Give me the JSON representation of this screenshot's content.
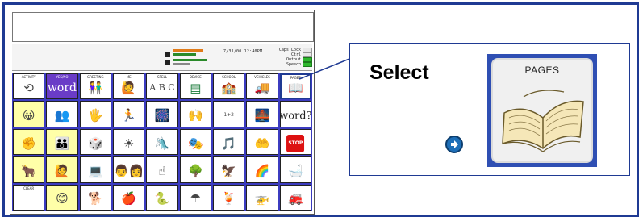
{
  "status": {
    "datetime": "7/31/00 12:40PM",
    "indicators": [
      {
        "label": "Caps Lock",
        "on": false
      },
      {
        "label": "Ctrl",
        "on": false
      },
      {
        "label": "Output",
        "on": true
      },
      {
        "label": "Speech",
        "on": true
      }
    ]
  },
  "keyboard": {
    "nav_keys": [
      {
        "label": "ACTIVITY",
        "icon": "⟲"
      },
      {
        "label": "YES/NO",
        "icon": "word"
      },
      {
        "label": "GREETING",
        "icon": "👫"
      },
      {
        "label": "ME",
        "icon": "🙋"
      },
      {
        "label": "SPELL",
        "icon": "A B C"
      },
      {
        "label": "DEVICE",
        "icon": "▤"
      },
      {
        "label": "SCHOOL",
        "icon": "🏫"
      },
      {
        "label": "VEHICLES",
        "icon": "🚚"
      },
      {
        "label": "PAGES",
        "icon": "📖"
      }
    ],
    "rows": [
      [
        {
          "icon": "😀",
          "yellow": true
        },
        {
          "icon": "👥",
          "yellow": false
        },
        {
          "icon": "🖐",
          "yellow": false
        },
        {
          "icon": "🏃",
          "yellow": false
        },
        {
          "icon": "🎆",
          "yellow": false
        },
        {
          "icon": "🙌",
          "yellow": false
        },
        {
          "icon": "1+2",
          "yellow": false
        },
        {
          "icon": "🌉",
          "yellow": false
        },
        {
          "icon": "word?",
          "yellow": false
        }
      ],
      [
        {
          "icon": "✊",
          "yellow": true
        },
        {
          "icon": "👪",
          "yellow": true
        },
        {
          "icon": "🎲",
          "yellow": false
        },
        {
          "icon": "☀",
          "yellow": false
        },
        {
          "icon": "🛝",
          "yellow": false
        },
        {
          "icon": "🎭",
          "yellow": false
        },
        {
          "icon": "🎵",
          "yellow": false
        },
        {
          "icon": "🤲",
          "yellow": false
        },
        {
          "icon": "STOP",
          "yellow": false
        }
      ],
      [
        {
          "icon": "🐂",
          "yellow": true
        },
        {
          "icon": "🙋",
          "yellow": true
        },
        {
          "icon": "💻",
          "yellow": false
        },
        {
          "icon": "👨‍👩",
          "yellow": false
        },
        {
          "icon": "☝",
          "yellow": false
        },
        {
          "icon": "🌳",
          "yellow": false
        },
        {
          "icon": "🦅",
          "yellow": false
        },
        {
          "icon": "🌈",
          "yellow": false
        },
        {
          "icon": "🛁",
          "yellow": false
        }
      ],
      [
        {
          "icon": "",
          "label": "CLEAR",
          "yellow": false
        },
        {
          "icon": "😊",
          "yellow": true
        },
        {
          "icon": "🐕",
          "yellow": false
        },
        {
          "icon": "🍎",
          "yellow": false
        },
        {
          "icon": "🐍",
          "yellow": false
        },
        {
          "icon": "☂",
          "yellow": false
        },
        {
          "icon": "🍹",
          "yellow": false
        },
        {
          "icon": "🚁",
          "yellow": false
        },
        {
          "icon": "🚒",
          "yellow": false
        }
      ]
    ]
  },
  "callout": {
    "instruction": "Select",
    "key_label": "PAGES",
    "key_icon": "open-book-icon"
  },
  "colors": {
    "frame": "#1f3a93",
    "grid": "#3c3cc0",
    "yellow_key": "#ffffa8",
    "nav_button": "#1e6fb8"
  }
}
